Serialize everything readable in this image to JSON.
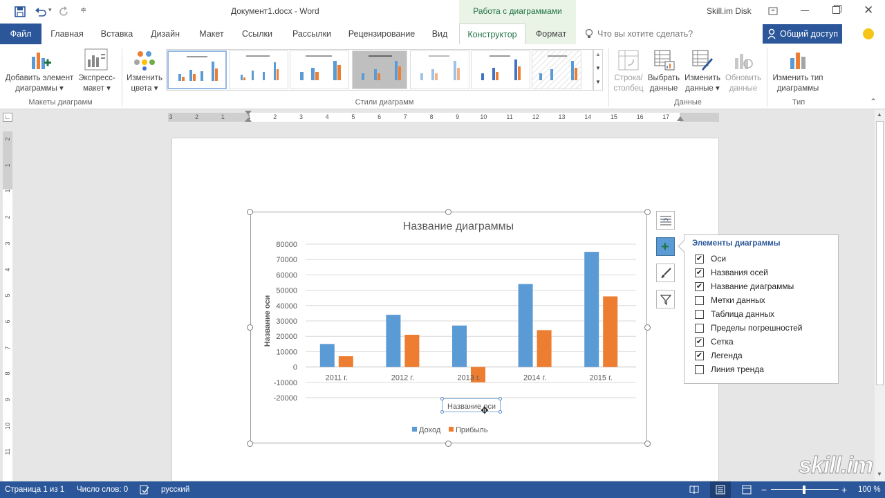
{
  "titlebar": {
    "doc_title": "Документ1.docx - Word",
    "context_header": "Работа с диаграммами",
    "account": "Skill.im Disk"
  },
  "tabs": {
    "file": "Файл",
    "items": [
      "Главная",
      "Вставка",
      "Дизайн",
      "Макет",
      "Ссылки",
      "Рассылки",
      "Рецензирование",
      "Вид",
      "Конструктор",
      "Формат"
    ],
    "tell_me": "Что вы хотите сделать?",
    "share": "Общий доступ"
  },
  "ribbon": {
    "add_element": [
      "Добавить элемент",
      "диаграммы ▾"
    ],
    "quick_layout": [
      "Экспресс-",
      "макет ▾"
    ],
    "change_colors": [
      "Изменить",
      "цвета ▾"
    ],
    "switch_row": [
      "Строка/",
      "столбец"
    ],
    "select_data": [
      "Выбрать",
      "данные"
    ],
    "edit_data": [
      "Изменить",
      "данные ▾"
    ],
    "refresh_data": [
      "Обновить",
      "данные"
    ],
    "change_type": [
      "Изменить тип",
      "диаграммы"
    ],
    "groups": {
      "layouts": "Макеты диаграмм",
      "styles": "Стили диаграмм",
      "data": "Данные",
      "type": "Тип"
    }
  },
  "ruler": {
    "labels": [
      "3",
      "2",
      "1",
      "1",
      "2",
      "3",
      "4",
      "5",
      "6",
      "7",
      "8",
      "9",
      "10",
      "11",
      "12",
      "13",
      "14",
      "15",
      "16",
      "17"
    ],
    "vlabels": [
      "2",
      "1",
      "1",
      "2",
      "3",
      "4",
      "5",
      "6",
      "7",
      "8",
      "9",
      "10",
      "11"
    ]
  },
  "chart_data": {
    "type": "bar",
    "title": "Название диаграммы",
    "categories": [
      "2011 г.",
      "2012 г.",
      "2013 г.",
      "2014 г.",
      "2015 г."
    ],
    "series": [
      {
        "name": "Доход",
        "color": "#5b9bd5",
        "values": [
          15000,
          34000,
          27000,
          54000,
          75000
        ]
      },
      {
        "name": "Прибыль",
        "color": "#ed7d31",
        "values": [
          7000,
          21000,
          -10000,
          24000,
          46000
        ]
      }
    ],
    "ylim": [
      -20000,
      80000
    ],
    "yticks": [
      80000,
      70000,
      60000,
      50000,
      40000,
      30000,
      20000,
      10000,
      0,
      -10000,
      -20000
    ],
    "ylabel": "Название оси",
    "xlabel": "Название оси",
    "grid": true,
    "legend": "bottom"
  },
  "chart_elements": {
    "title": "Элементы диаграммы",
    "items": [
      {
        "label": "Оси",
        "checked": true
      },
      {
        "label": "Названия осей",
        "checked": true
      },
      {
        "label": "Название диаграммы",
        "checked": true
      },
      {
        "label": "Метки данных",
        "checked": false
      },
      {
        "label": "Таблица данных",
        "checked": false
      },
      {
        "label": "Пределы погрешностей",
        "checked": false
      },
      {
        "label": "Сетка",
        "checked": true
      },
      {
        "label": "Легенда",
        "checked": true
      },
      {
        "label": "Линия тренда",
        "checked": false
      }
    ]
  },
  "statusbar": {
    "page": "Страница 1 из 1",
    "words": "Число слов: 0",
    "language": "русский",
    "zoom": "100 %"
  },
  "watermark": "skill.im",
  "colors": {
    "accent": "#2b579a",
    "context": "#217346",
    "series1": "#5b9bd5",
    "series2": "#ed7d31"
  }
}
